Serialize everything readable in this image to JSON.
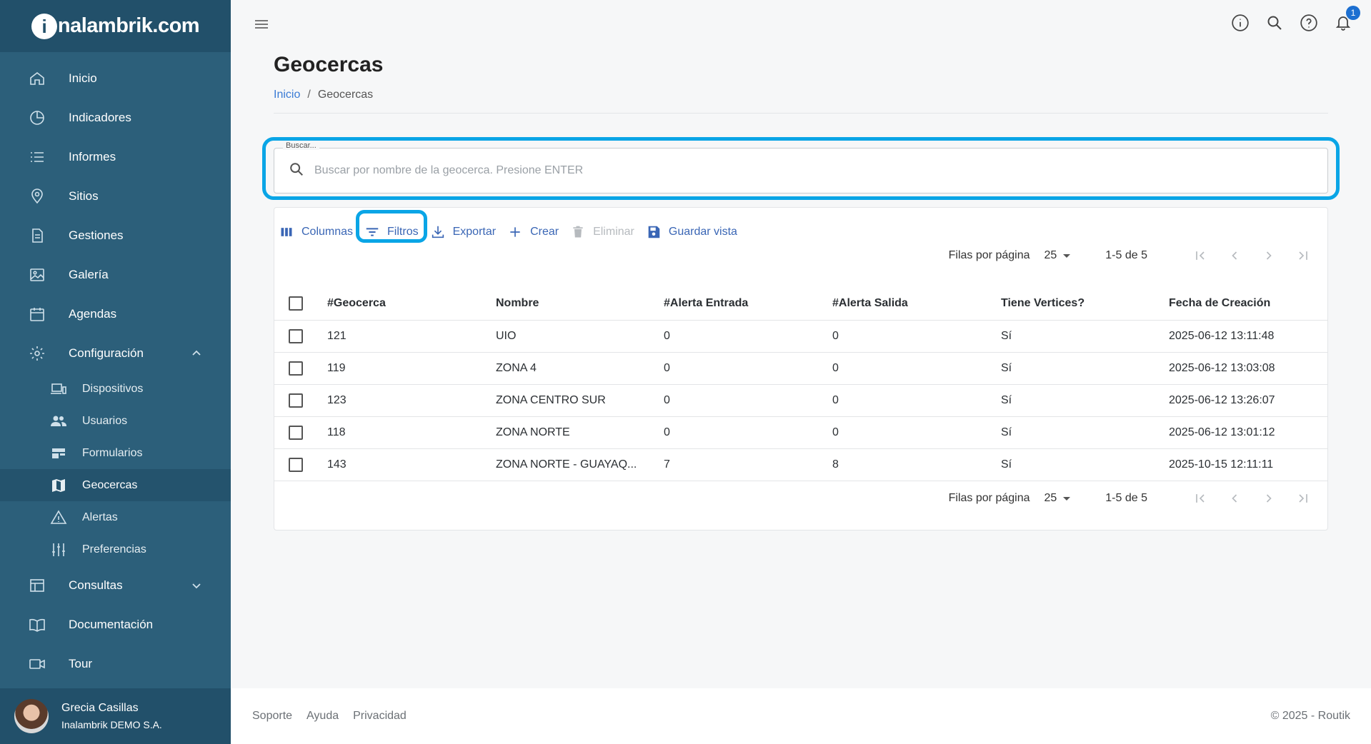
{
  "brand": {
    "name": "nalambrik.com",
    "logo_letter": "i"
  },
  "sidebar": {
    "items": [
      {
        "label": "Inicio",
        "icon": "home-icon"
      },
      {
        "label": "Indicadores",
        "icon": "pie-chart-icon"
      },
      {
        "label": "Informes",
        "icon": "list-icon"
      },
      {
        "label": "Sitios",
        "icon": "location-pin-icon"
      },
      {
        "label": "Gestiones",
        "icon": "document-icon"
      },
      {
        "label": "Galería",
        "icon": "image-icon"
      },
      {
        "label": "Agendas",
        "icon": "calendar-icon"
      },
      {
        "label": "Configuración",
        "icon": "gear-icon"
      }
    ],
    "config_subitems": [
      {
        "label": "Dispositivos",
        "icon": "devices-icon"
      },
      {
        "label": "Usuarios",
        "icon": "users-icon"
      },
      {
        "label": "Formularios",
        "icon": "forms-icon"
      },
      {
        "label": "Geocercas",
        "icon": "map-icon"
      },
      {
        "label": "Alertas",
        "icon": "warning-icon"
      },
      {
        "label": "Preferencias",
        "icon": "sliders-icon"
      }
    ],
    "bottom_items": [
      {
        "label": "Consultas",
        "icon": "table-icon"
      },
      {
        "label": "Documentación",
        "icon": "book-icon"
      },
      {
        "label": "Tour",
        "icon": "video-icon"
      }
    ]
  },
  "user": {
    "name": "Grecia Casillas",
    "org": "Inalambrik DEMO S.A."
  },
  "topbar": {
    "notification_count": "1"
  },
  "page": {
    "title": "Geocercas",
    "breadcrumb": {
      "home": "Inicio",
      "separator": "/",
      "current": "Geocercas"
    }
  },
  "search": {
    "legend": "Buscar...",
    "placeholder": "Buscar por nombre de la geocerca. Presione ENTER"
  },
  "toolbar": {
    "columns": "Columnas",
    "filters": "Filtros",
    "export": "Exportar",
    "create": "Crear",
    "delete": "Eliminar",
    "save_view": "Guardar vista"
  },
  "pager": {
    "rows_label": "Filas por página",
    "rows_value": "25",
    "range": "1-5 de 5"
  },
  "table": {
    "headers": [
      "#Geocerca",
      "Nombre",
      "#Alerta Entrada",
      "#Alerta Salida",
      "Tiene Vertices?",
      "Fecha de Creación"
    ],
    "rows": [
      [
        "121",
        "UIO",
        "0",
        "0",
        "Sí",
        "2025-06-12 13:11:48"
      ],
      [
        "119",
        "ZONA 4",
        "0",
        "0",
        "Sí",
        "2025-06-12 13:03:08"
      ],
      [
        "123",
        "ZONA CENTRO SUR",
        "0",
        "0",
        "Sí",
        "2025-06-12 13:26:07"
      ],
      [
        "118",
        "ZONA NORTE",
        "0",
        "0",
        "Sí",
        "2025-06-12 13:01:12"
      ],
      [
        "143",
        "ZONA NORTE - GUAYAQ...",
        "7",
        "8",
        "Sí",
        "2025-10-15 12:11:11"
      ]
    ]
  },
  "footer": {
    "support": "Soporte",
    "help": "Ayuda",
    "privacy": "Privacidad",
    "copyright": "© 2025 - Routik"
  },
  "colors": {
    "sidebar": "#2c5f7a",
    "sidebar_dark": "#22506a",
    "accent": "#3a66b5",
    "highlight": "#0aa5e6"
  }
}
